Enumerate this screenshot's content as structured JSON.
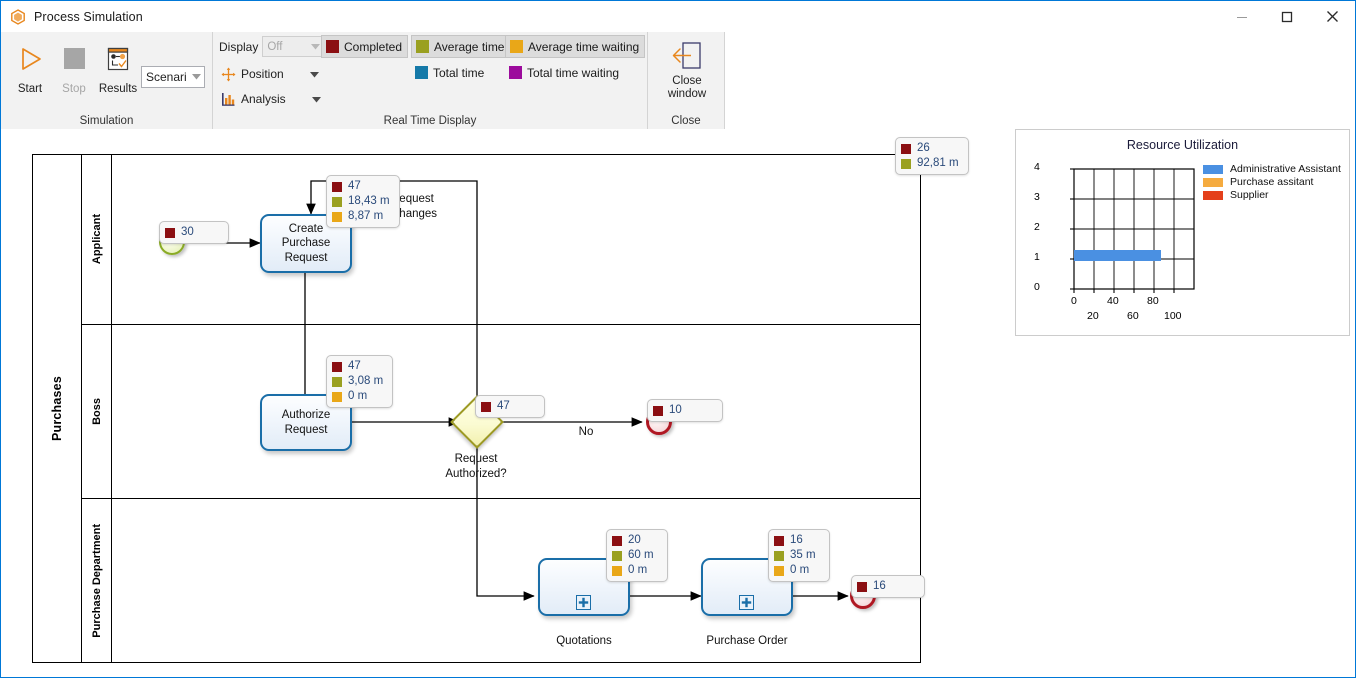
{
  "window": {
    "title": "Process Simulation",
    "app_icon": "hexagon-orange-icon",
    "minimize": "minimize-icon",
    "maximize": "maximize-icon",
    "close": "close-icon"
  },
  "ribbon": {
    "groups": [
      {
        "name": "Simulation",
        "title": "Simulation",
        "buttons": [
          {
            "label": "Start",
            "icon": "play-triangle-icon",
            "enabled": true
          },
          {
            "label": "Stop",
            "icon": "stop-square-icon",
            "enabled": false
          },
          {
            "label": "Results",
            "icon": "results-report-icon",
            "enabled": true
          }
        ],
        "scenario": {
          "value": "Scenari",
          "arrow": "chevron-down-icon"
        }
      },
      {
        "name": "Real Time Display",
        "title": "Real Time Display",
        "display_label": "Display",
        "display_value": "Off",
        "menu_items": [
          {
            "label": "Position",
            "icon": "move-cross-icon",
            "caret": "chevron-down-icon"
          },
          {
            "label": "Analysis",
            "icon": "bar-chart-icon",
            "caret": "chevron-down-icon"
          }
        ],
        "chips": [
          {
            "label": "Completed",
            "color": "#8b0f12",
            "selected": true
          },
          {
            "label": "Average time",
            "color": "#9aa020",
            "selected": true
          },
          {
            "label": "Average time waiting",
            "color": "#e9a718",
            "selected": true
          },
          {
            "label": "Total time",
            "color": "#1579a8",
            "selected": false
          },
          {
            "label": "Total time waiting",
            "color": "#9c0b9c",
            "selected": false
          }
        ]
      },
      {
        "name": "Close",
        "title": "Close",
        "button": {
          "label": "Close\nwindow",
          "line1": "Close",
          "line2": "window",
          "icon": "close-window-arrow-icon"
        }
      }
    ]
  },
  "colors": {
    "completed": "#8b0f12",
    "average_time": "#9aa020",
    "average_time_waiting": "#e9a718",
    "total_time": "#1579a8",
    "total_time_waiting": "#9c0b9c",
    "task_border": "#1a6ea8",
    "gateway_border": "#9d9a23",
    "start_border": "#8aab25",
    "end_border": "#b01823"
  },
  "diagram": {
    "pool_name": "Purchases",
    "lanes": [
      {
        "name": "Applicant"
      },
      {
        "name": "Boss"
      },
      {
        "name": "Purchase Department"
      }
    ],
    "nodes": [
      {
        "id": "start",
        "type": "start-event",
        "label": ""
      },
      {
        "id": "create",
        "type": "task",
        "label": "Create\nPurchase\nRequest",
        "line1": "Create",
        "line2": "Purchase",
        "line3": "Request"
      },
      {
        "id": "authorize",
        "type": "task",
        "label": "Authorize\nRequest",
        "line1": "Authorize",
        "line2": "Request"
      },
      {
        "id": "gateway",
        "type": "exclusive-gateway",
        "label": "Request\nAuthorized?",
        "line1": "Request",
        "line2": "Authorized?"
      },
      {
        "id": "end_no",
        "type": "end-event",
        "label": ""
      },
      {
        "id": "quotations",
        "type": "sub-process",
        "label": "Quotations"
      },
      {
        "id": "purchase_order",
        "type": "sub-process",
        "label": "Purchase Order"
      },
      {
        "id": "end_ok",
        "type": "end-event",
        "label": ""
      }
    ],
    "flow_labels": [
      {
        "id": "request_changes",
        "line1": "Request",
        "line2": "Changes"
      },
      {
        "id": "no",
        "text": "No"
      }
    ],
    "badges": [
      {
        "id": "process-total",
        "rows": [
          {
            "color": "#8b0f12",
            "value": "26"
          },
          {
            "color": "#9aa020",
            "value": "92,81 m"
          }
        ]
      },
      {
        "id": "start-badge",
        "rows": [
          {
            "color": "#8b0f12",
            "value": "30"
          }
        ]
      },
      {
        "id": "create-badge",
        "rows": [
          {
            "color": "#8b0f12",
            "value": "47"
          },
          {
            "color": "#9aa020",
            "value": "18,43 m"
          },
          {
            "color": "#e9a718",
            "value": "8,87 m"
          }
        ]
      },
      {
        "id": "authorize-badge",
        "rows": [
          {
            "color": "#8b0f12",
            "value": "47"
          },
          {
            "color": "#9aa020",
            "value": "3,08 m"
          },
          {
            "color": "#e9a718",
            "value": "0 m"
          }
        ]
      },
      {
        "id": "gateway-badge",
        "rows": [
          {
            "color": "#8b0f12",
            "value": "47"
          }
        ]
      },
      {
        "id": "end-no-badge",
        "rows": [
          {
            "color": "#8b0f12",
            "value": "10"
          }
        ]
      },
      {
        "id": "quotations-badge",
        "rows": [
          {
            "color": "#8b0f12",
            "value": "20"
          },
          {
            "color": "#9aa020",
            "value": "60 m"
          },
          {
            "color": "#e9a718",
            "value": "0 m"
          }
        ]
      },
      {
        "id": "purchase-order-badge",
        "rows": [
          {
            "color": "#8b0f12",
            "value": "16"
          },
          {
            "color": "#9aa020",
            "value": "35 m"
          },
          {
            "color": "#e9a718",
            "value": "0 m"
          }
        ]
      },
      {
        "id": "end-ok-badge",
        "rows": [
          {
            "color": "#8b0f12",
            "value": "16"
          }
        ]
      }
    ]
  },
  "chart_data": {
    "type": "bar",
    "orientation": "horizontal",
    "title": "Resource Utilization",
    "xlabel": "",
    "ylabel": "",
    "xlim": [
      0,
      120
    ],
    "ylim": [
      0,
      4
    ],
    "xticks": [
      0,
      20,
      40,
      60,
      80,
      100
    ],
    "xticklabels": [
      "0",
      "20",
      "40",
      "60",
      "80",
      "100"
    ],
    "yticks": [
      0,
      1,
      2,
      3,
      4
    ],
    "yticklabels": [
      "0",
      "1",
      "2",
      "3",
      "4"
    ],
    "grid": true,
    "legend_position": "right",
    "categories": [
      "Administrative Assistant",
      "Purchase assitant",
      "Supplier"
    ],
    "series": [
      {
        "name": "Administrative Assistant",
        "color": "#4a90e2",
        "value": 87,
        "y": 1.28
      },
      {
        "name": "Purchase assitant",
        "color": "#f5ab3f",
        "value": 0,
        "y": 2.28
      },
      {
        "name": "Supplier",
        "color": "#e4401b",
        "value": 0,
        "y": 3.28
      }
    ]
  }
}
